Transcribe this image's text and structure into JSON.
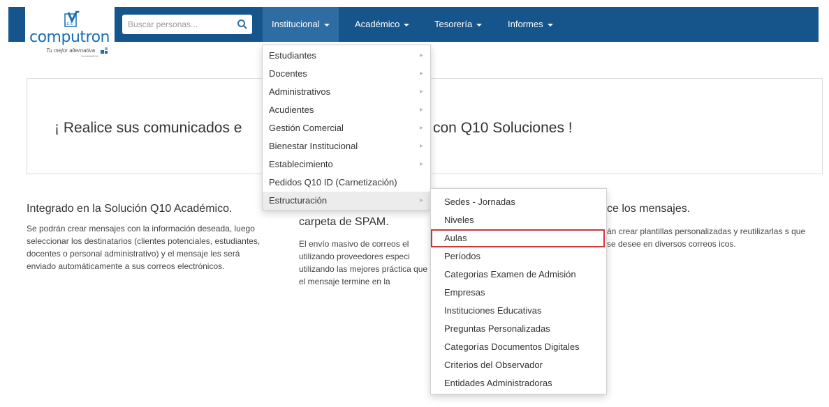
{
  "logo": {
    "brand": "computron",
    "tagline": "Tu mejor alternativa",
    "mark_text": "I.E.S",
    "sub_tagline": "CAJAMARCA"
  },
  "search": {
    "placeholder": "Buscar personas..."
  },
  "nav": [
    {
      "label": "Institucional"
    },
    {
      "label": "Académico"
    },
    {
      "label": "Tesorería"
    },
    {
      "label": "Informes"
    }
  ],
  "banner": {
    "text_a": "¡ Realice sus comunicados e",
    "text_b": "con Q10 Soluciones !"
  },
  "columns": [
    {
      "title": "Integrado en la Solución Q10 Académico.",
      "body": "Se podrán crear mensajes con la información deseada, luego seleccionar los destinatarios (clientes potenciales, estudiantes, docentes o personal administrativo) y el mensaje les será enviado automáticamente a sus correos electrónicos."
    },
    {
      "title": "carpeta de SPAM.",
      "body": "El envío masivo de correos el utilizando proveedores especi utilizando las mejores práctica que el mensaje termine en la"
    },
    {
      "title": "ce los mensajes.",
      "body": "án crear plantillas personalizadas y reutilizarlas s que se desee en diversos correos icos."
    }
  ],
  "dropdown": {
    "items": [
      {
        "label": "Estudiantes",
        "has_sub": true
      },
      {
        "label": "Docentes",
        "has_sub": true
      },
      {
        "label": "Administrativos",
        "has_sub": true
      },
      {
        "label": "Acudientes",
        "has_sub": true
      },
      {
        "label": "Gestión Comercial",
        "has_sub": true
      },
      {
        "label": "Bienestar Institucional",
        "has_sub": true
      },
      {
        "label": "Establecimiento",
        "has_sub": true
      },
      {
        "label": "Pedidos Q10 ID (Carnetización)",
        "has_sub": false
      },
      {
        "label": "Estructuración",
        "has_sub": true
      }
    ]
  },
  "submenu": {
    "items": [
      {
        "label": "Sedes - Jornadas"
      },
      {
        "label": "Niveles"
      },
      {
        "label": "Aulas"
      },
      {
        "label": "Períodos"
      },
      {
        "label": "Categorias Examen de Admisión"
      },
      {
        "label": "Empresas"
      },
      {
        "label": "Instituciones Educativas"
      },
      {
        "label": "Preguntas Personalizadas"
      },
      {
        "label": "Categorías Documentos Digitales"
      },
      {
        "label": "Criterios del Observador"
      },
      {
        "label": "Entidades Administradoras"
      }
    ]
  },
  "colors": {
    "navbar": "#15558c",
    "nav_active": "#2e6da4",
    "highlight_border": "#c9383a",
    "brand_blue": "#1a6fb5"
  },
  "icons": {
    "search": "search-icon",
    "submenu_arrow": "chevron-right-icon",
    "dropdown_caret": "caret-down-icon"
  }
}
